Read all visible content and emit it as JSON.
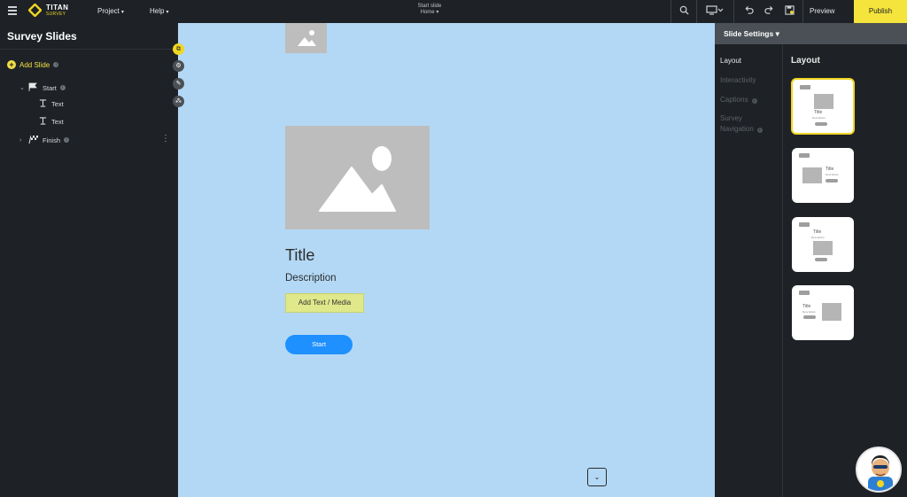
{
  "app": {
    "logo_main": "TITAN",
    "logo_sub": "SURVEY"
  },
  "topbar": {
    "menus": [
      "Project",
      "Help"
    ],
    "center_title": "Start slide",
    "center_subtitle": "Home",
    "preview_label": "Preview",
    "publish_label": "Publish"
  },
  "sidebar": {
    "title": "Survey Slides",
    "add_slide_label": "Add Slide",
    "tree": [
      {
        "label": "Start",
        "type": "slide",
        "expanded": true
      },
      {
        "label": "Text",
        "type": "element"
      },
      {
        "label": "Text",
        "type": "element"
      },
      {
        "label": "Finish",
        "type": "slide",
        "expanded": false
      }
    ]
  },
  "canvas": {
    "title": "Title",
    "description": "Description",
    "add_media_label": "Add Text / Media",
    "start_button_label": "Start"
  },
  "right_panel": {
    "header": "Slide Settings",
    "nav": [
      "Layout",
      "Interactivity",
      "Captions",
      "Survey Navigation"
    ],
    "active_nav": "Layout",
    "layout_heading": "Layout",
    "layouts": [
      {
        "title": "Title",
        "desc": "Description",
        "selected": true
      },
      {
        "title": "Title",
        "desc": "Description",
        "selected": false
      },
      {
        "title": "Title",
        "desc": "Description",
        "selected": false
      },
      {
        "title": "Title",
        "desc": "Description",
        "selected": false
      }
    ]
  },
  "colors": {
    "accent": "#f0d623",
    "canvas_bg": "#b3d8f5",
    "start_button": "#1e90ff",
    "dark_bg": "#1e2226"
  }
}
